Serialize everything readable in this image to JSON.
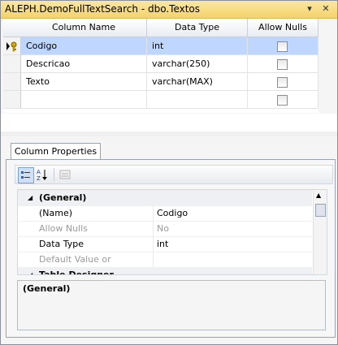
{
  "window": {
    "title": "ALEPH.DemoFullTextSearch - dbo.Textos",
    "pin_icon": "▾",
    "close_icon": "✕"
  },
  "grid": {
    "columns": [
      "Column Name",
      "Data Type",
      "Allow Nulls"
    ],
    "rows": [
      {
        "name": "Codigo",
        "type": "int",
        "nulls": false,
        "selected": true,
        "key": true
      },
      {
        "name": "Descricao",
        "type": "varchar(250)",
        "nulls": false
      },
      {
        "name": "Texto",
        "type": "varchar(MAX)",
        "nulls": false
      },
      {
        "name": "",
        "type": "",
        "nulls": false
      }
    ]
  },
  "tabs": {
    "column_properties": "Column Properties"
  },
  "properties": {
    "general_category": "(General)",
    "items": [
      {
        "name": "(Name)",
        "value": "Codigo",
        "muted": false
      },
      {
        "name": "Allow Nulls",
        "value": "No",
        "muted": true
      },
      {
        "name": "Data Type",
        "value": "int",
        "muted": false
      },
      {
        "name": "Default Value or Binding",
        "value": "",
        "muted": true
      }
    ],
    "designer_category": "Table Designer"
  },
  "description": {
    "title": "(General)"
  }
}
